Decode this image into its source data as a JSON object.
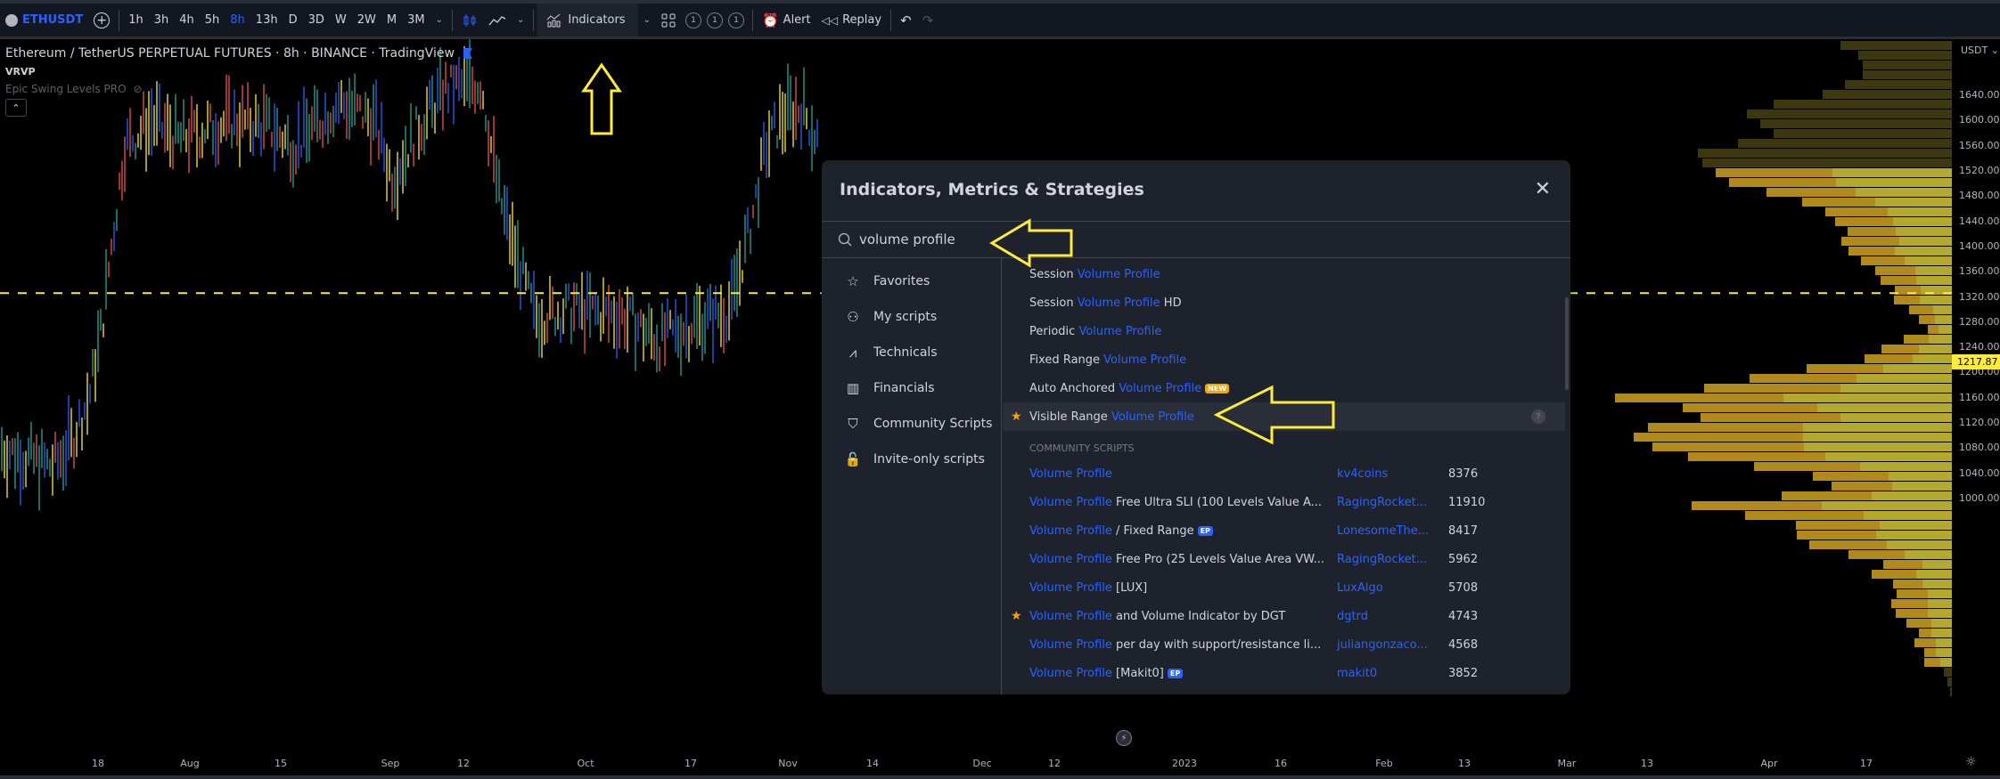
{
  "toolbar": {
    "symbol": "ETHUSDT",
    "timeframes": [
      "1h",
      "3h",
      "4h",
      "5h",
      "8h",
      "13h",
      "D",
      "3D",
      "W",
      "2W",
      "M",
      "3M"
    ],
    "active_timeframe": "8h",
    "indicators_label": "Indicators",
    "layout_counters": [
      "1",
      "1",
      "1"
    ],
    "alert_label": "Alert",
    "replay_label": "Replay"
  },
  "legend": {
    "title": "Ethereum / TetherUS PERPETUAL FUTURES · 8h · BINANCE · TradingView",
    "indicator1": "VRVP",
    "indicator2": "Epic Swing Levels PRO"
  },
  "price_axis": {
    "unit": "USDT",
    "labels": [
      "1640.00",
      "1600.00",
      "1560.00",
      "1520.00",
      "1480.00",
      "1440.00",
      "1400.00",
      "1360.00",
      "1320.00",
      "1280.00",
      "1240.00",
      "1200.00",
      "1160.00",
      "1120.00",
      "1080.00",
      "1040.00",
      "1000.00"
    ],
    "current_price": "1217.87",
    "dashed_level": 1326
  },
  "time_axis": {
    "labels": [
      "18",
      "Aug",
      "15",
      "Sep",
      "12",
      "Oct",
      "17",
      "Nov",
      "14",
      "Dec",
      "12",
      "2023",
      "16",
      "Feb",
      "13",
      "Mar",
      "13",
      "Apr",
      "17"
    ]
  },
  "dialog": {
    "title": "Indicators, Metrics & Strategies",
    "search_value": "volume profile",
    "nav": [
      {
        "label": "Favorites",
        "icon": "star-icon"
      },
      {
        "label": "My scripts",
        "icon": "user-icon"
      },
      {
        "label": "Technicals",
        "icon": "technicals-icon"
      },
      {
        "label": "Financials",
        "icon": "financials-icon"
      },
      {
        "label": "Community Scripts",
        "icon": "bookmark-icon"
      },
      {
        "label": "Invite-only scripts",
        "icon": "lock-icon"
      }
    ],
    "builtins": [
      {
        "prefix": "Session",
        "match": "Volume Profile",
        "suffix": "",
        "badge": "",
        "fav": false
      },
      {
        "prefix": "Session",
        "match": "Volume Profile",
        "suffix": "HD",
        "badge": "",
        "fav": false
      },
      {
        "prefix": "Periodic",
        "match": "Volume Profile",
        "suffix": "",
        "badge": "",
        "fav": false
      },
      {
        "prefix": "Fixed Range",
        "match": "Volume Profile",
        "suffix": "",
        "badge": "",
        "fav": false
      },
      {
        "prefix": "Auto Anchored",
        "match": "Volume Profile",
        "suffix": "",
        "badge": "NEW",
        "fav": false
      },
      {
        "prefix": "Visible Range",
        "match": "Volume Profile",
        "suffix": "",
        "badge": "",
        "fav": true
      }
    ],
    "community_header": "COMMUNITY SCRIPTS",
    "community": [
      {
        "match": "Volume Profile",
        "suffix": "",
        "badge": "",
        "author": "kv4coins",
        "count": "8376",
        "fav": false
      },
      {
        "match": "Volume Profile",
        "suffix": "Free Ultra SLI (100 Levels Value A...",
        "badge": "",
        "author": "RagingRocket...",
        "count": "11910",
        "fav": false
      },
      {
        "match": "Volume Profile",
        "suffix": "/ Fixed Range",
        "badge": "EP",
        "author": "LonesomeThe...",
        "count": "8417",
        "fav": false
      },
      {
        "match": "Volume Profile",
        "suffix": "Free Pro (25 Levels Value Area VW...",
        "badge": "",
        "author": "RagingRocket...",
        "count": "5962",
        "fav": false
      },
      {
        "match": "Volume Profile",
        "suffix": "[LUX]",
        "badge": "",
        "author": "LuxAlgo",
        "count": "5708",
        "fav": false
      },
      {
        "match": "Volume Profile",
        "suffix": "and Volume Indicator by DGT",
        "badge": "",
        "author": "dgtrd",
        "count": "4743",
        "fav": true
      },
      {
        "match": "Volume Profile",
        "suffix": "per day with support/resistance li...",
        "badge": "",
        "author": "juliangonzaco...",
        "count": "4568",
        "fav": false
      },
      {
        "match": "Volume Profile",
        "suffix": "[Makit0]",
        "badge": "EP",
        "author": "makit0",
        "count": "3852",
        "fav": false
      }
    ]
  },
  "colors": {
    "accent": "#2962ff",
    "annotation": "#ffeb3b",
    "vp_up": "#b5a82e",
    "vp_down": "#b08a1c",
    "vp_outside": "#3d3810"
  }
}
